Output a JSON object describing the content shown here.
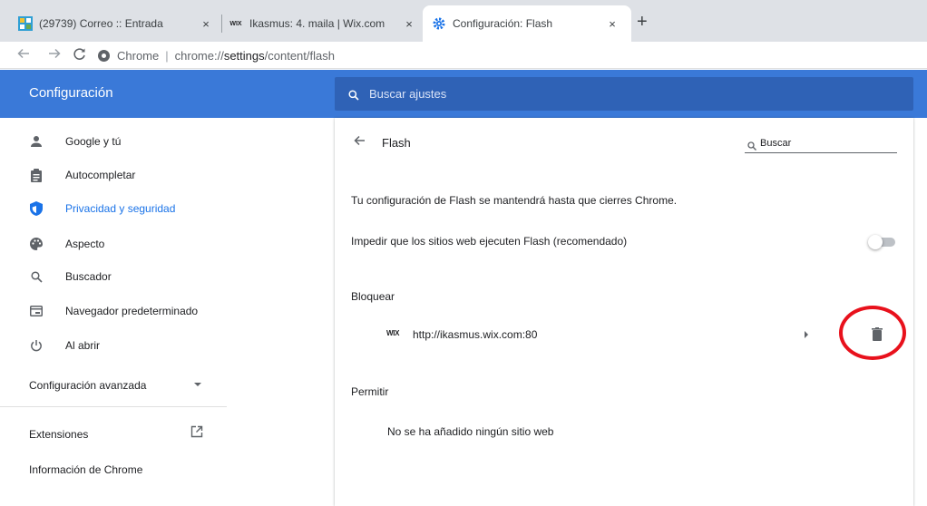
{
  "browser": {
    "tabs": [
      {
        "title": "(29739) Correo :: Entrada",
        "icon": "mail-app-icon"
      },
      {
        "title": "Ikasmus: 4. maila | Wix.com",
        "icon": "wix-icon",
        "favicon_text": "WIX"
      },
      {
        "title": "Configuración: Flash",
        "icon": "settings-gear-icon",
        "active": true
      }
    ],
    "new_tab": "+",
    "close_glyph": "×",
    "address_bar": {
      "label": "Chrome",
      "separator": "|",
      "url_prefix": "chrome://",
      "url_path": "settings",
      "url_rest": "/content/flash"
    }
  },
  "header": {
    "title": "Configuración",
    "search_placeholder": "Buscar ajustes"
  },
  "sidebar": {
    "items": [
      {
        "label": "Google y tú",
        "icon": "person-icon"
      },
      {
        "label": "Autocompletar",
        "icon": "clipboard-icon"
      },
      {
        "label": "Privacidad y seguridad",
        "icon": "shield-icon",
        "active": true
      },
      {
        "label": "Aspecto",
        "icon": "palette-icon"
      },
      {
        "label": "Buscador",
        "icon": "search-icon"
      },
      {
        "label": "Navegador predeterminado",
        "icon": "browser-window-icon"
      },
      {
        "label": "Al abrir",
        "icon": "power-icon"
      }
    ],
    "advanced_label": "Configuración avanzada",
    "extensions_label": "Extensiones",
    "about_label": "Información de Chrome"
  },
  "main": {
    "page_title": "Flash",
    "search_placeholder": "Buscar",
    "notice": "Tu configuración de Flash se mantendrá hasta que cierres Chrome.",
    "toggle_label": "Impedir que los sitios web ejecuten Flash (recomendado)",
    "toggle_on": false,
    "block_section": "Bloquear",
    "blocked_sites": [
      {
        "favicon_text": "WIX",
        "url": "http://ikasmus.wix.com:80"
      }
    ],
    "allow_section": "Permitir",
    "allow_empty": "No se ha añadido ningún sitio web"
  },
  "colors": {
    "header_bg": "#3a79d8",
    "search_bg": "#2f62b6",
    "accent": "#1a73e8",
    "annotation_circle": "#e8111c"
  }
}
